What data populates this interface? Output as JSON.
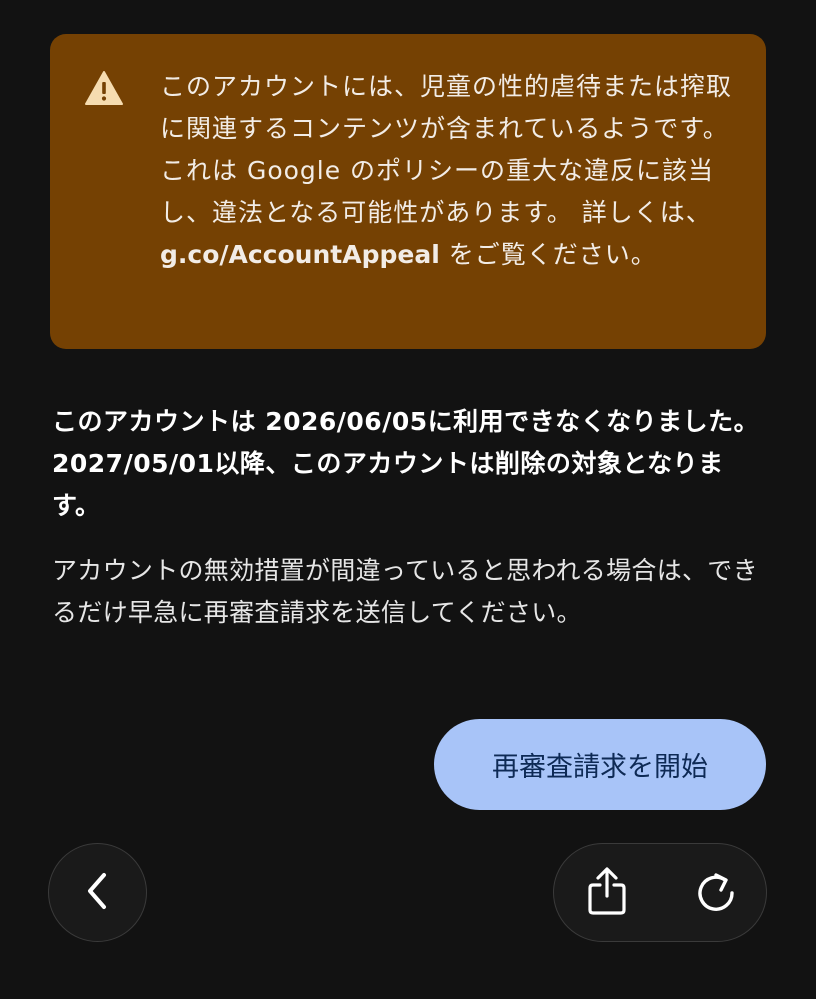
{
  "warning": {
    "icon": "warning-triangle-icon",
    "text_before_link": "このアカウントには、児童の性的虐待または搾取に関連するコンテンツが含まれているようです。これは Google のポリシーの重大な違反に該当し、違法となる可能性があります。 詳しくは、",
    "link": "g.co/AccountAppeal",
    "text_after_link": " をご覧ください。",
    "background": "#754103"
  },
  "status_text": "このアカウントは 2026/06/05に利用できなくなりました。2027/05/01以降、このアカウントは削除の対象となります。",
  "info_text": "アカウントの無効措置が間違っていると思われる場合は、できるだけ早急に再審査請求を送信してください。",
  "appeal_button": {
    "label": "再審査請求を開始",
    "color": "#a8c4f8"
  },
  "nav": {
    "back_icon": "chevron-left-icon",
    "share_icon": "share-icon",
    "reload_icon": "reload-icon"
  }
}
